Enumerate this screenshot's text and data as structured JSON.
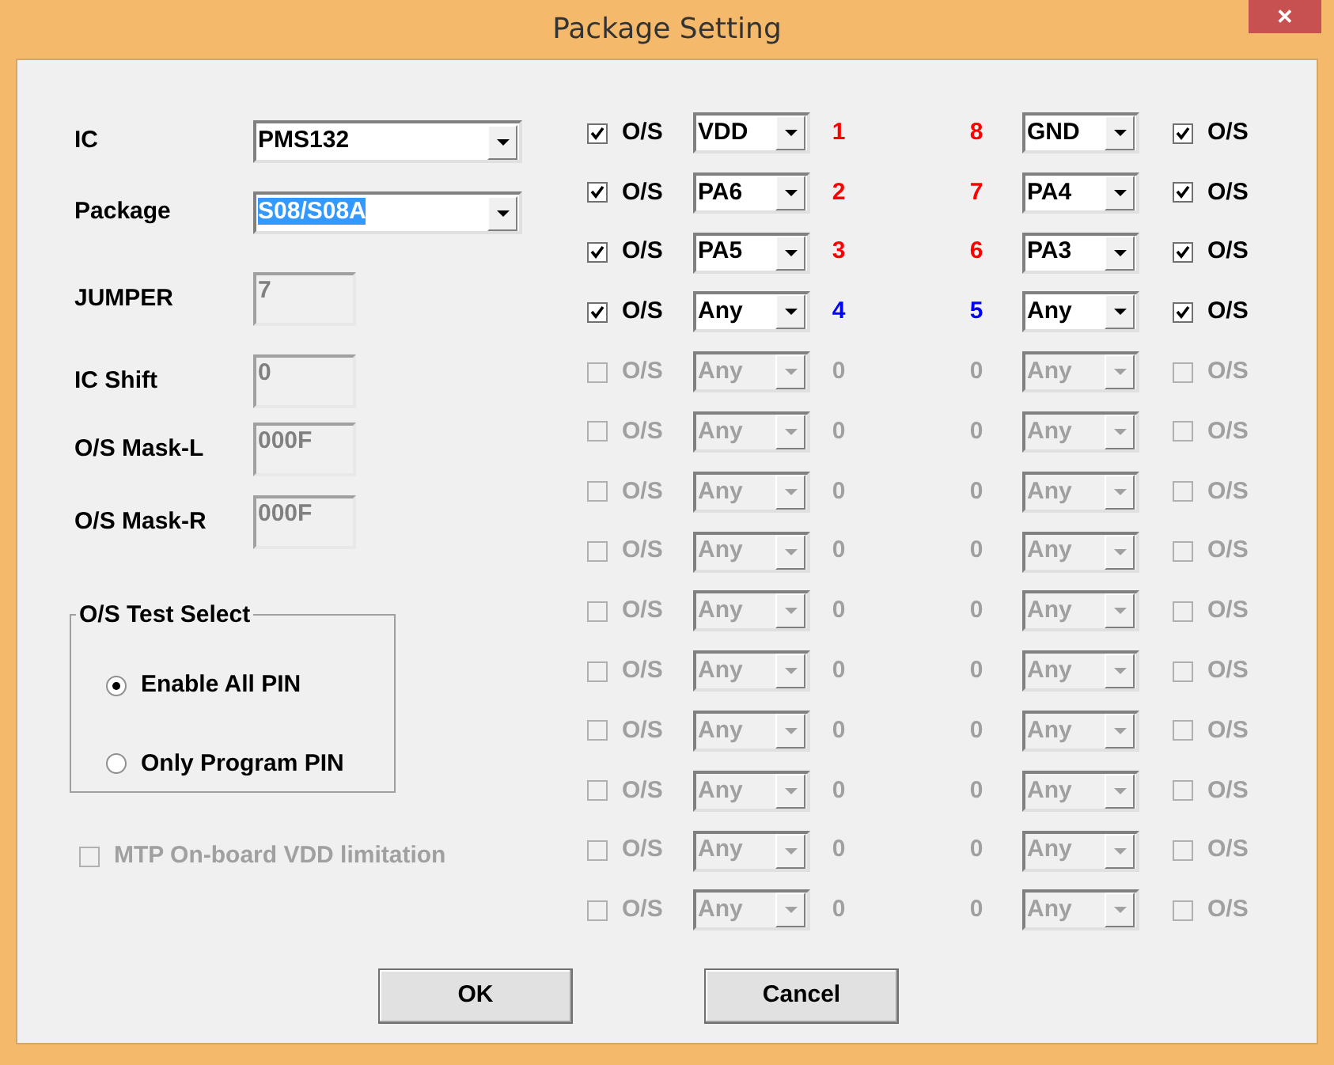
{
  "window": {
    "title": "Package Setting",
    "close": "✕"
  },
  "fields": [
    {
      "label": "IC",
      "value": "PMS132",
      "kind": "dropdown",
      "text_selected": false
    },
    {
      "label": "Package",
      "value": "S08/S08A",
      "kind": "dropdown",
      "text_selected": true
    },
    {
      "label": "JUMPER",
      "value": "7",
      "kind": "readonly"
    },
    {
      "label": "IC Shift",
      "value": "0",
      "kind": "readonly"
    },
    {
      "label": "O/S Mask-L",
      "value": "000F",
      "kind": "readonly"
    },
    {
      "label": "O/S Mask-R",
      "value": "000F",
      "kind": "readonly"
    }
  ],
  "os_test_select": {
    "title": "O/S Test Select",
    "options": [
      {
        "label": "Enable All PIN",
        "selected": true
      },
      {
        "label": "Only Program PIN",
        "selected": false
      }
    ]
  },
  "mtp_option": {
    "label": "MTP On-board VDD limitation",
    "checked": false,
    "disabled": true
  },
  "pin_rows": [
    {
      "left": {
        "checked": true,
        "label": "O/S",
        "value": "VDD",
        "number": "1",
        "color": "#ff0000",
        "disabled": false
      },
      "right": {
        "number": "8",
        "color": "#ff0000",
        "value": "GND",
        "checked": true,
        "label": "O/S",
        "disabled": false
      }
    },
    {
      "left": {
        "checked": true,
        "label": "O/S",
        "value": "PA6",
        "number": "2",
        "color": "#ff0000",
        "disabled": false
      },
      "right": {
        "number": "7",
        "color": "#ff0000",
        "value": "PA4",
        "checked": true,
        "label": "O/S",
        "disabled": false
      }
    },
    {
      "left": {
        "checked": true,
        "label": "O/S",
        "value": "PA5",
        "number": "3",
        "color": "#ff0000",
        "disabled": false
      },
      "right": {
        "number": "6",
        "color": "#ff0000",
        "value": "PA3",
        "checked": true,
        "label": "O/S",
        "disabled": false
      }
    },
    {
      "left": {
        "checked": true,
        "label": "O/S",
        "value": "Any",
        "number": "4",
        "color": "#0000ff",
        "disabled": false
      },
      "right": {
        "number": "5",
        "color": "#0000ff",
        "value": "Any",
        "checked": true,
        "label": "O/S",
        "disabled": false
      }
    },
    {
      "left": {
        "checked": false,
        "label": "O/S",
        "value": "Any",
        "number": "0",
        "color": "#a0a0a0",
        "disabled": true
      },
      "right": {
        "number": "0",
        "color": "#a0a0a0",
        "value": "Any",
        "checked": false,
        "label": "O/S",
        "disabled": true
      }
    },
    {
      "left": {
        "checked": false,
        "label": "O/S",
        "value": "Any",
        "number": "0",
        "color": "#a0a0a0",
        "disabled": true
      },
      "right": {
        "number": "0",
        "color": "#a0a0a0",
        "value": "Any",
        "checked": false,
        "label": "O/S",
        "disabled": true
      }
    },
    {
      "left": {
        "checked": false,
        "label": "O/S",
        "value": "Any",
        "number": "0",
        "color": "#a0a0a0",
        "disabled": true
      },
      "right": {
        "number": "0",
        "color": "#a0a0a0",
        "value": "Any",
        "checked": false,
        "label": "O/S",
        "disabled": true
      }
    },
    {
      "left": {
        "checked": false,
        "label": "O/S",
        "value": "Any",
        "number": "0",
        "color": "#a0a0a0",
        "disabled": true
      },
      "right": {
        "number": "0",
        "color": "#a0a0a0",
        "value": "Any",
        "checked": false,
        "label": "O/S",
        "disabled": true
      }
    },
    {
      "left": {
        "checked": false,
        "label": "O/S",
        "value": "Any",
        "number": "0",
        "color": "#a0a0a0",
        "disabled": true
      },
      "right": {
        "number": "0",
        "color": "#a0a0a0",
        "value": "Any",
        "checked": false,
        "label": "O/S",
        "disabled": true
      }
    },
    {
      "left": {
        "checked": false,
        "label": "O/S",
        "value": "Any",
        "number": "0",
        "color": "#a0a0a0",
        "disabled": true
      },
      "right": {
        "number": "0",
        "color": "#a0a0a0",
        "value": "Any",
        "checked": false,
        "label": "O/S",
        "disabled": true
      }
    },
    {
      "left": {
        "checked": false,
        "label": "O/S",
        "value": "Any",
        "number": "0",
        "color": "#a0a0a0",
        "disabled": true
      },
      "right": {
        "number": "0",
        "color": "#a0a0a0",
        "value": "Any",
        "checked": false,
        "label": "O/S",
        "disabled": true
      }
    },
    {
      "left": {
        "checked": false,
        "label": "O/S",
        "value": "Any",
        "number": "0",
        "color": "#a0a0a0",
        "disabled": true
      },
      "right": {
        "number": "0",
        "color": "#a0a0a0",
        "value": "Any",
        "checked": false,
        "label": "O/S",
        "disabled": true
      }
    },
    {
      "left": {
        "checked": false,
        "label": "O/S",
        "value": "Any",
        "number": "0",
        "color": "#a0a0a0",
        "disabled": true
      },
      "right": {
        "number": "0",
        "color": "#a0a0a0",
        "value": "Any",
        "checked": false,
        "label": "O/S",
        "disabled": true
      }
    },
    {
      "left": {
        "checked": false,
        "label": "O/S",
        "value": "Any",
        "number": "0",
        "color": "#a0a0a0",
        "disabled": true
      },
      "right": {
        "number": "0",
        "color": "#a0a0a0",
        "value": "Any",
        "checked": false,
        "label": "O/S",
        "disabled": true
      }
    }
  ],
  "buttons": [
    {
      "label": "OK"
    },
    {
      "label": "Cancel"
    }
  ]
}
